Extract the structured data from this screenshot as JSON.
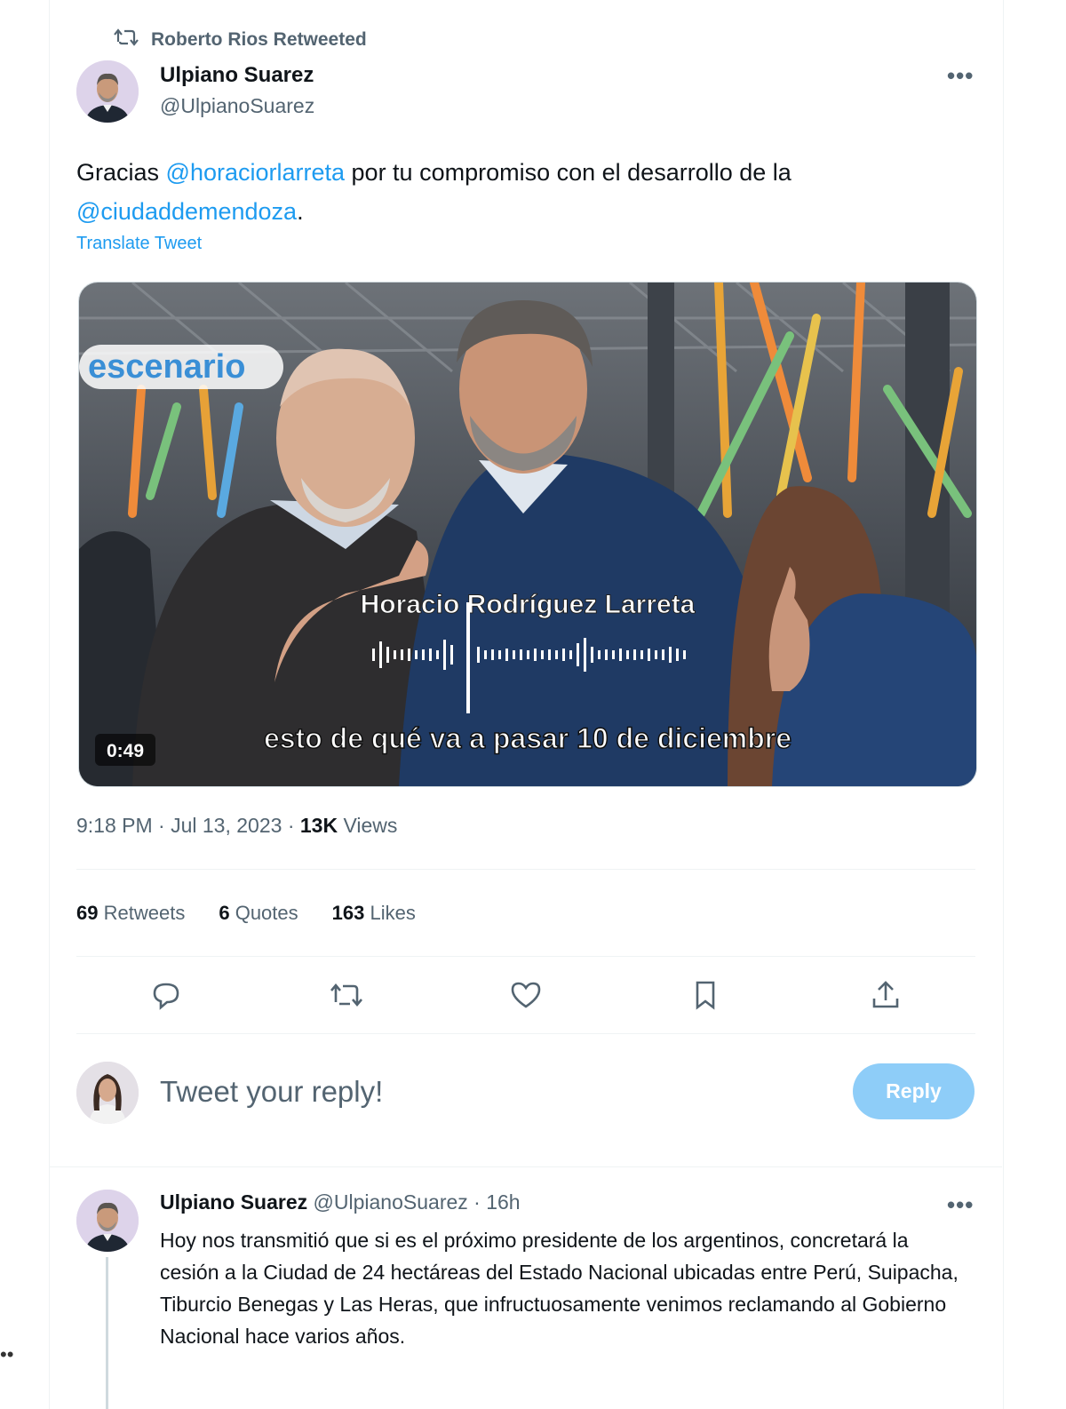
{
  "retweet_banner": {
    "text": "Roberto Rios Retweeted",
    "icon": "retweet-icon"
  },
  "tweet": {
    "author_name": "Ulpiano Suarez",
    "author_handle": "@UlpianoSuarez",
    "text_before": "Gracias ",
    "mention1": "@horaciorlarreta",
    "text_middle": " por tu compromiso con el desarrollo de la",
    "mention2": "@ciudaddemendoza",
    "text_after": ".",
    "translate_label": "Translate Tweet",
    "video": {
      "logo_text": "escenario",
      "caption_speaker": "Horacio Rodríguez Larreta",
      "subtitle": "esto de qué va a pasar 10 de diciembre",
      "duration": "0:49"
    },
    "timestamp": "9:18 PM · Jul 13, 2023",
    "views_count": "13K",
    "views_label": "Views",
    "stats": {
      "retweets_count": "69",
      "retweets_label": "Retweets",
      "quotes_count": "6",
      "quotes_label": "Quotes",
      "likes_count": "163",
      "likes_label": "Likes"
    }
  },
  "actions": [
    "reply-icon",
    "retweet-icon",
    "like-icon",
    "bookmark-icon",
    "share-icon"
  ],
  "reply_box": {
    "placeholder": "Tweet your reply!",
    "button_label": "Reply"
  },
  "reply_tweet": {
    "author_name": "Ulpiano Suarez",
    "author_handle": "@UlpianoSuarez",
    "time": "· 16h",
    "text": "Hoy nos transmitió que si es el próximo presidente de los argentinos, concretará la cesión a la Ciudad de 24 hectáreas del Estado Nacional ubicadas entre Perú, Suipacha, Tiburcio Benegas y Las Heras, que infructuosamente venimos reclamando al Gobierno Nacional hace varios años."
  },
  "colors": {
    "accent": "#1d9bf0",
    "muted": "#536471",
    "reply_button": "#8ecdf8"
  }
}
